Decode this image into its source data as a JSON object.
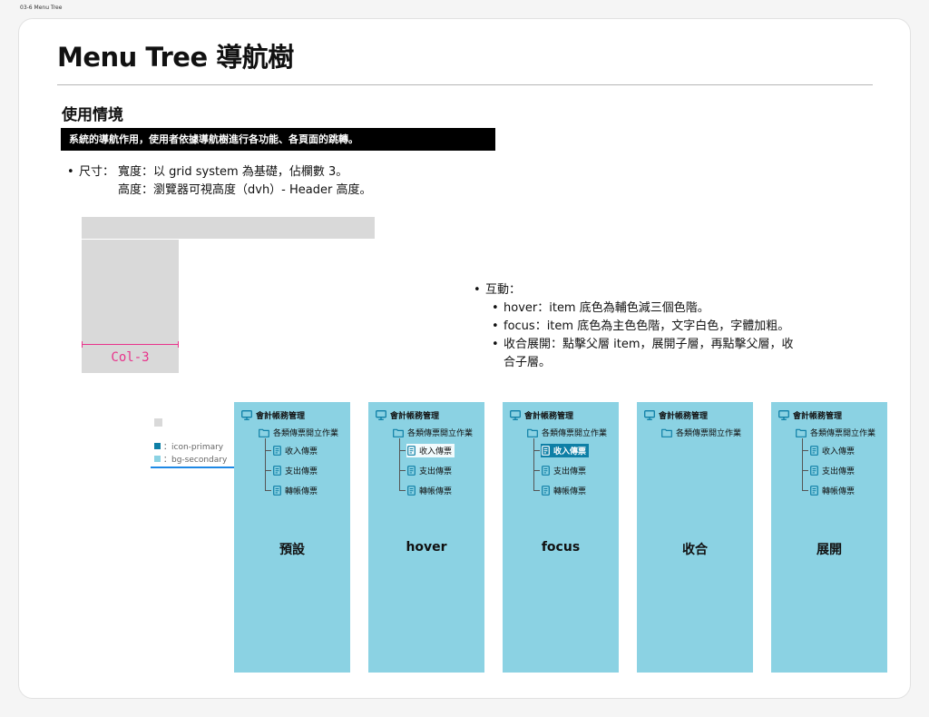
{
  "frame_label": "03-6 Menu Tree",
  "title": "Menu Tree 導航樹",
  "section": {
    "title": "使用情境",
    "banner": "系統的導航作用，使用者依據導航樹進行各功能、各頁面的跳轉。"
  },
  "size": {
    "label": "尺寸：",
    "width_text": "寬度：以 grid system 為基礎，佔欄數 3。",
    "height_text": "高度：瀏覽器可視高度（dvh）- Header 高度。"
  },
  "demo": {
    "col_label": "Col-3"
  },
  "interaction": {
    "title": "互動：",
    "items": [
      "hover：item 底色為輔色減三個色階。",
      "focus：item 底色為主色色階，文字白色，字體加粗。",
      "收合展開：點擊父層 item，展開子層，再點擊父層，收",
      "合子層。"
    ]
  },
  "legend": {
    "items": [
      {
        "label": "：icon-primary",
        "color": "#0e7fa6"
      },
      {
        "label": "：bg-secondary",
        "color": "#8bd2e3"
      }
    ]
  },
  "tree": {
    "root": "會計帳務管理",
    "group": "各類傳票開立作業",
    "leaves": [
      "收入傳票",
      "支出傳票",
      "轉帳傳票"
    ]
  },
  "states": [
    "預設",
    "hover",
    "focus",
    "收合",
    "展開"
  ],
  "colors": {
    "icon_primary": "#0e7fa6",
    "bg_secondary": "#8bd2e3",
    "measure": "#e8338b"
  },
  "icons": {
    "root": "monitor-icon",
    "group": "folder-icon",
    "leaf": "document-icon"
  }
}
